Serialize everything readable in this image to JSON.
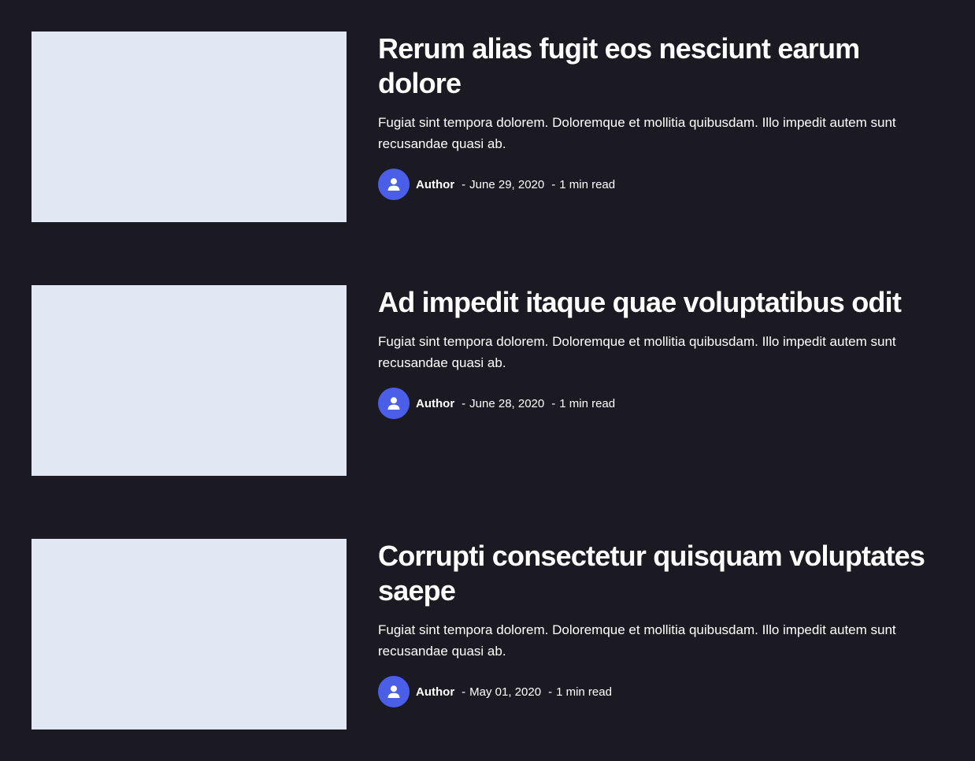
{
  "posts": [
    {
      "title": "Rerum alias fugit eos nesciunt earum dolore",
      "excerpt": "Fugiat sint tempora dolorem. Doloremque et mollitia quibusdam. Illo impedit autem sunt recusandae quasi ab.",
      "author": "Author",
      "date": "June 29, 2020",
      "read_time": "1 min read"
    },
    {
      "title": "Ad impedit itaque quae voluptatibus odit",
      "excerpt": "Fugiat sint tempora dolorem. Doloremque et mollitia quibusdam. Illo impedit autem sunt recusandae quasi ab.",
      "author": "Author",
      "date": "June 28, 2020",
      "read_time": "1 min read"
    },
    {
      "title": "Corrupti consectetur quisquam voluptates saepe",
      "excerpt": "Fugiat sint tempora dolorem. Doloremque et mollitia quibusdam. Illo impedit autem sunt recusandae quasi ab.",
      "author": "Author",
      "date": "May 01, 2020",
      "read_time": "1 min read"
    }
  ],
  "meta_separator": "-",
  "colors": {
    "background": "#1b1a23",
    "thumbnail": "#e1e8f4",
    "avatar": "#4a5ee8",
    "text": "#ffffff"
  },
  "icons": {
    "avatar": "user-icon"
  }
}
